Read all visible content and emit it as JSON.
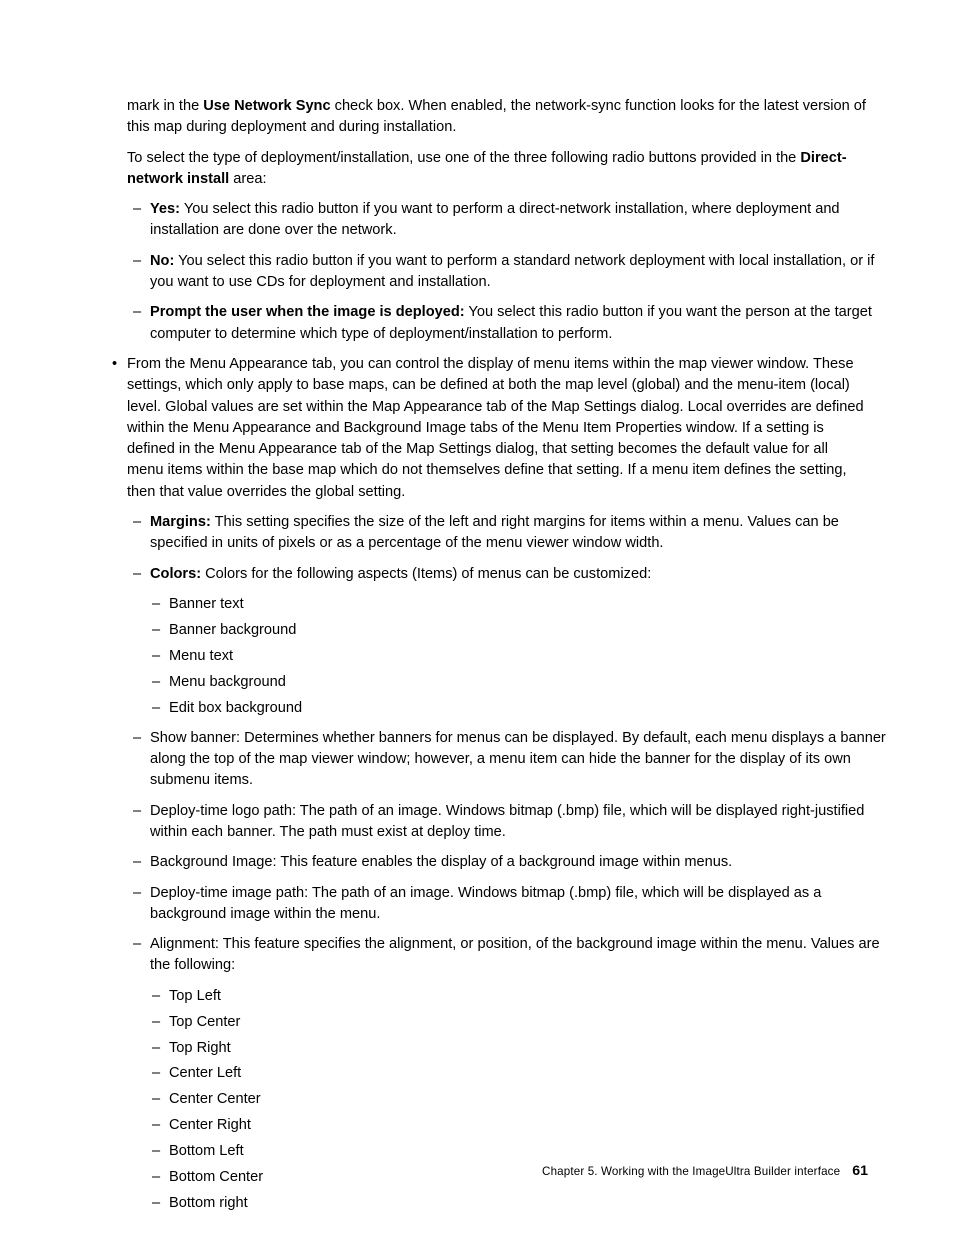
{
  "page": {
    "number": "61",
    "footer_chapter": "Chapter 5. Working with the ImageUltra Builder interface",
    "background_color": "#ffffff",
    "text_color": "#000000"
  },
  "markers": {
    "bullet": "•",
    "dash": "–"
  },
  "body": {
    "para_network_sync": {
      "pre": "mark in the ",
      "bold": "Use Network Sync",
      "post": " check box. When enabled, the network-sync function looks for the latest version of this map during deployment and during installation."
    },
    "para_deployment_type": {
      "pre": "To select the type of deployment/installation, use one of the three following radio buttons provided in the ",
      "bold": "Direct-network install",
      "post": " area:"
    },
    "radio_items": [
      {
        "label": "Yes:",
        "text": " You select this radio button if you want to perform a direct-network installation, where deployment and installation are done over the network."
      },
      {
        "label": "No:",
        "text": " You select this radio button if you want to perform a standard network deployment with local installation, or if you want to use CDs for deployment and installation."
      },
      {
        "label": "Prompt the user when the image is deployed:",
        "text": " You select this radio button if you want the person at the target computer to determine which type of deployment/installation to perform."
      }
    ],
    "menu_appearance_bullet": "From the Menu Appearance tab, you can control the display of menu items within the map viewer window. These settings, which only apply to base maps, can be defined at both the map level (global) and the menu-item (local) level. Global values are set within the Map Appearance tab of the Map Settings dialog. Local overrides are defined within the Menu Appearance and Background Image tabs of the Menu Item Properties window. If a setting is defined in the Menu Appearance tab of the Map Settings dialog, that setting becomes the default value for all menu items within the base map which do not themselves define that setting. If a menu item defines the setting, then that value overrides the global setting.",
    "margins_item": {
      "label": "Margins:",
      "text": " This setting specifies the size of the left and right margins for items within a menu. Values can be specified in units of pixels or as a percentage of the menu viewer window width."
    },
    "colors_item": {
      "label": "Colors:",
      "text": " Colors for the following aspects (Items) of menus can be customized:"
    },
    "colors_list": [
      "Banner text",
      "Banner background",
      "Menu text",
      "Menu background",
      "Edit box background"
    ],
    "settings_items": [
      "Show banner: Determines whether banners for menus can be displayed. By default, each menu displays a banner along the top of the map viewer window; however, a menu item can hide the banner for the display of its own submenu items.",
      "Deploy-time logo path: The path of an image. Windows bitmap (.bmp) file, which will be displayed right-justified within each banner. The path must exist at deploy time.",
      "Background Image: This feature enables the display of a background image within menus.",
      "Deploy-time image path: The path of an image. Windows bitmap (.bmp) file, which will be displayed as a background image within the menu.",
      "Alignment: This feature specifies the alignment, or position, of the background image within the menu. Values are the following:"
    ],
    "alignment_values": [
      "Top Left",
      "Top Center",
      "Top Right",
      "Center Left",
      "Center Center",
      "Center Right",
      "Bottom Left",
      "Bottom Center",
      "Bottom right"
    ]
  }
}
